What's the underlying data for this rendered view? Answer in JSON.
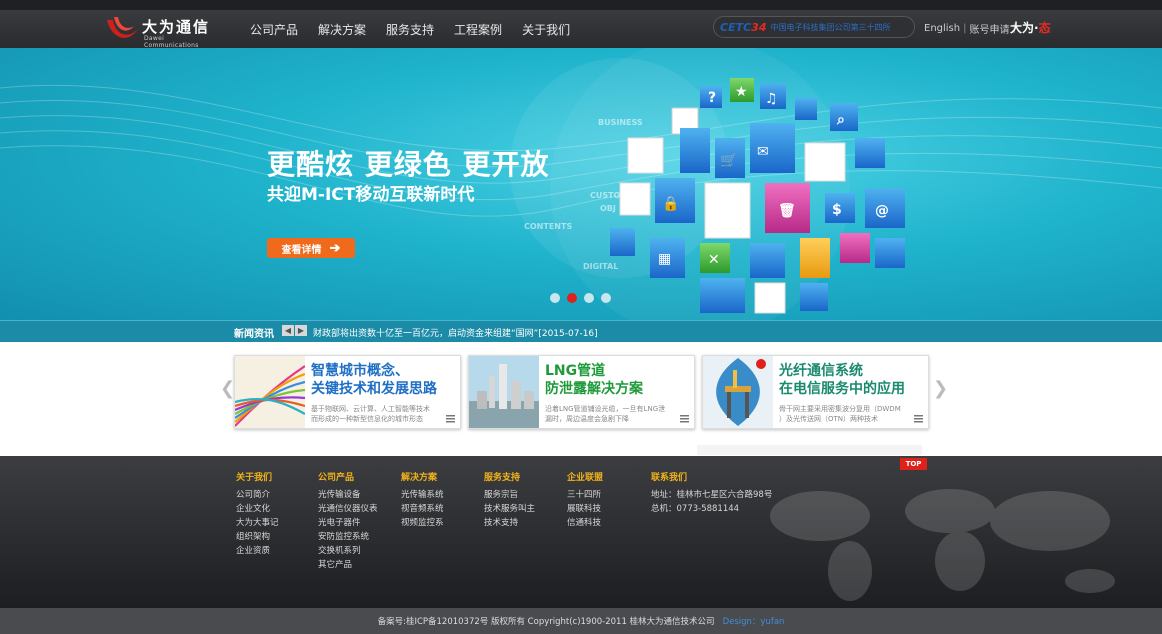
{
  "header": {
    "logo_text": "大为通信",
    "logo_sub": "Dawei Communications",
    "nav": [
      "公司产品",
      "解决方案",
      "服务支持",
      "工程案例",
      "关于我们"
    ],
    "cetc_logo": "CETC",
    "cetc_num": "34",
    "cetc_text": "中国电子科技集团公司第三十四所",
    "lang": "English",
    "account": "账号申请",
    "sep": "|",
    "brand_text": "大为",
    "brand_dot": "·",
    "brand_mark": "态"
  },
  "banner": {
    "title": "更酷炫  更绿色  更开放",
    "subtitle": "共迎M-ICT移动互联新时代",
    "button": "查看详情",
    "button_arrow": "➔",
    "words": [
      "BUSINESS",
      "CUSTO",
      "OBJ",
      "CONTENTS",
      "DIGITAL"
    ],
    "dots": 4,
    "active_dot": 1
  },
  "news": {
    "label": "新闻资讯",
    "prev": "◀",
    "next": "▶",
    "text": "财政部将出资数十亿至一百亿元，启动资金来组建“国网”[2015-07-16]"
  },
  "cards": [
    {
      "title1": "智慧城市概念、",
      "title2": "关键技术和发展思路",
      "desc1": "基于物联网、云计算、人工智能等技术",
      "desc2": "而形成的一种新型信息化的城市形态",
      "color": "#1f6fc4"
    },
    {
      "title1": "LNG管道",
      "title2": "防泄露解决方案",
      "desc1": "沿着LNG管道铺设光缆，一旦有LNG泄",
      "desc2": "漏时，周边温度会急剧下降",
      "color": "#1f9a3a"
    },
    {
      "title1": "光纤通信系统",
      "title2": "在电信服务中的应用",
      "desc1": "骨干网主要采用密集波分复用（DWDM",
      "desc2": "）及光传送网（OTN）两种技术",
      "color": "#1a8a6e"
    }
  ],
  "carousel_prev": "❮",
  "carousel_next": "❯",
  "footer": {
    "top": "TOP",
    "columns": [
      {
        "title": "关于我们",
        "items": [
          "公司简介",
          "企业文化",
          "大为大事记",
          "组织架构",
          "企业资质"
        ]
      },
      {
        "title": "公司产品",
        "items": [
          "光传输设备",
          "光通信仪器仪表",
          "光电子器件",
          "安防监控系统",
          "交换机系列",
          "其它产品"
        ]
      },
      {
        "title": "解决方案",
        "items": [
          "光传输系统",
          "视音频系统",
          "视频监控系"
        ]
      },
      {
        "title": "服务支持",
        "items": [
          "服务宗旨",
          "技术服务叫主",
          "技术支持"
        ]
      },
      {
        "title": "企业联盟",
        "items": [
          "三十四所",
          "展联科技",
          "信通科技"
        ]
      }
    ],
    "contact_title": "联系我们",
    "address": "地址：桂林市七星区六合路98号",
    "phone": "总机：0773-5881144"
  },
  "copyright": {
    "text": "备案号:桂ICP备12010372号  版权所有 Copyright(c)1900-2011  桂林大为通信技术公司",
    "design": "Design：yufan"
  },
  "colors": {
    "accent": "#f06a1b",
    "banner": "#1fb3cc",
    "red": "#e0201a",
    "footer_title": "#f2b21a"
  }
}
